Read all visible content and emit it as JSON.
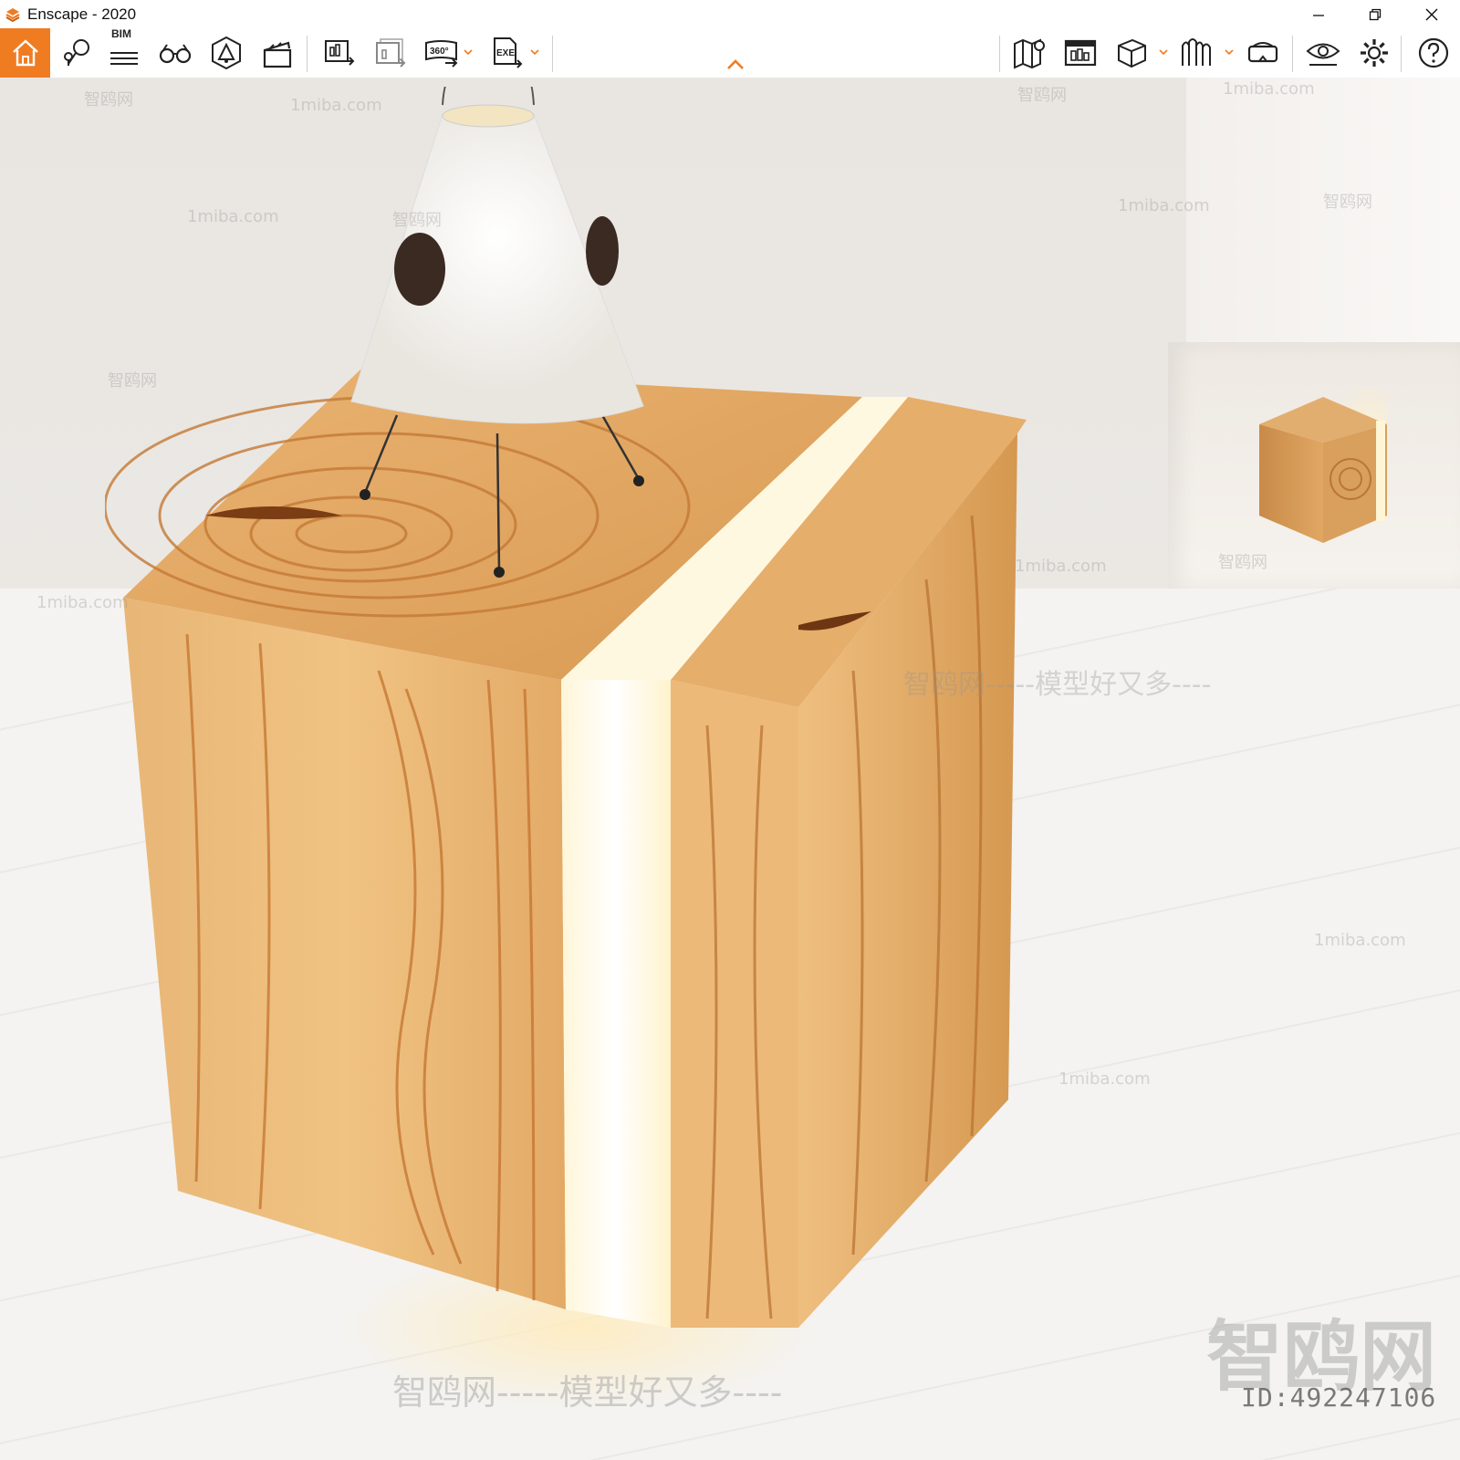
{
  "window": {
    "title": "Enscape - 2020",
    "accent_color": "#f07c22"
  },
  "toolbar": {
    "left_tools": [
      {
        "icon": "home-icon"
      },
      {
        "icon": "location-pin-icon"
      },
      {
        "icon": "bim-icon",
        "label": "BIM"
      },
      {
        "icon": "binoculars-icon"
      },
      {
        "icon": "object-lock-icon"
      },
      {
        "icon": "clapperboard-icon"
      },
      {
        "icon": "screenshot-export-icon"
      },
      {
        "icon": "batch-render-icon"
      },
      {
        "icon": "panorama-360-icon",
        "label": "360°"
      },
      {
        "icon": "exe-export-icon",
        "label": "EXE"
      }
    ],
    "right_tools": [
      {
        "icon": "map-icon"
      },
      {
        "icon": "view-management-icon"
      },
      {
        "icon": "cube-icon"
      },
      {
        "icon": "asset-library-icon"
      },
      {
        "icon": "vr-headset-icon"
      },
      {
        "icon": "visual-settings-eye-icon"
      },
      {
        "icon": "gear-icon"
      },
      {
        "icon": "help-icon"
      }
    ]
  },
  "viewport": {
    "watermarks": {
      "site_cn": "智鸥网",
      "site_url": "1miba.com",
      "slogan": "智鸥网-----模型好又多----",
      "big_logo": "智鸥网",
      "id_text": "ID:492247106"
    }
  }
}
